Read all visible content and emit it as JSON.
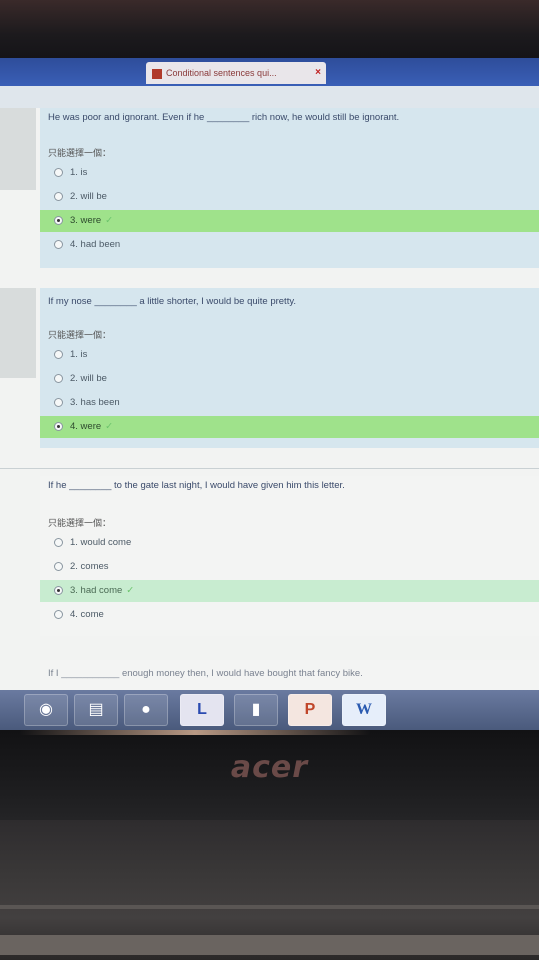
{
  "browser": {
    "tab_title": "Conditional sentences qui...",
    "tab_close": "×"
  },
  "questions": [
    {
      "text": "He was poor and ignorant.  Even if he ________ rich now, he would still be ignorant.",
      "prompt": "只能選擇一個：",
      "options": [
        {
          "label": "1. is",
          "selected": false
        },
        {
          "label": "2. will be",
          "selected": false
        },
        {
          "label": "3. were",
          "selected": true,
          "correct": true
        },
        {
          "label": "4. had been",
          "selected": false
        }
      ]
    },
    {
      "text": "If my nose ________ a little shorter, I would be quite pretty.",
      "prompt": "只能選擇一個：",
      "options": [
        {
          "label": "1. is",
          "selected": false
        },
        {
          "label": "2. will be",
          "selected": false
        },
        {
          "label": "3. has been",
          "selected": false
        },
        {
          "label": "4. were",
          "selected": true,
          "correct": true
        }
      ]
    },
    {
      "text": "If he ________ to the gate last night, I would have given him this letter.",
      "prompt": "只能選擇一個：",
      "options": [
        {
          "label": "1. would come",
          "selected": false
        },
        {
          "label": "2. comes",
          "selected": false
        },
        {
          "label": "3. had come",
          "selected": true,
          "correct": true
        },
        {
          "label": "4. come",
          "selected": false
        }
      ]
    },
    {
      "text": "If I ___________ enough money then, I would have bought that fancy bike."
    }
  ],
  "taskbar": {
    "items": [
      "firefox-icon",
      "folder-icon",
      "media-player-icon",
      "library-icon",
      "phone-app-icon",
      "powerpoint-icon",
      "word-icon"
    ],
    "powerpoint_glyph": "P",
    "word_glyph": "W",
    "library_glyph": "L"
  },
  "device": {
    "brand": "acer"
  },
  "colors": {
    "correct_highlight": "#9fe28b",
    "question_bg": "#d6e6ee",
    "taskbar": "#5a6a8c"
  }
}
